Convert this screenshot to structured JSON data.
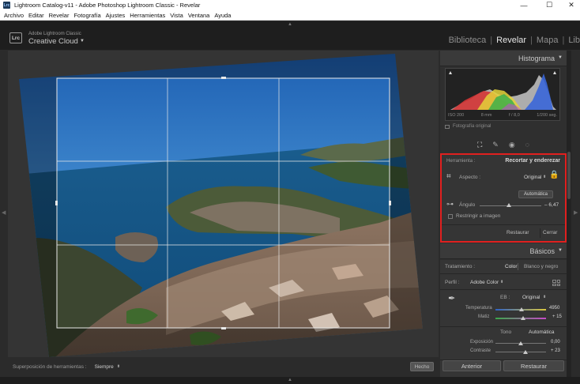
{
  "window": {
    "title": "Lightroom Catalog-v11 - Adobe Photoshop Lightroom Classic - Revelar",
    "app_icon": "Lrc",
    "controls": [
      "—",
      "☐",
      "✕"
    ]
  },
  "menu": [
    "Archivo",
    "Editar",
    "Revelar",
    "Fotografía",
    "Ajustes",
    "Herramientas",
    "Vista",
    "Ventana",
    "Ayuda"
  ],
  "brand": {
    "badge": "Lrc",
    "small": "Adobe Lightroom Classic",
    "big": "Creative Cloud",
    "caret": "▼"
  },
  "modules": {
    "items": [
      "Biblioteca",
      "Revelar",
      "Mapa",
      "Lib"
    ],
    "active_index": 1
  },
  "toolbar": {
    "overlay_label": "Superposición de herramientas :",
    "overlay_value": "Siempre",
    "done_label": "Hecho"
  },
  "histogram": {
    "title": "Histograma",
    "iso": "ISO 200",
    "focal": "8 mm",
    "aperture": "f / 8,0",
    "shutter": "1/200 seg.",
    "original_photo_label": "Fotografía original"
  },
  "crop": {
    "tools_label": "Herramienta :",
    "title": "Recortar y enderezar",
    "aspect_label": "Aspecto :",
    "aspect_value": "Original",
    "auto_label": "Automática",
    "angle_label": "Ángulo",
    "angle_value": "– 6,47",
    "angle_slider_fraction": 0.47,
    "constrain_label": "Restringir a imagen",
    "reset_label": "Restaurar",
    "close_label": "Cerrar"
  },
  "basics": {
    "title": "Básicos",
    "treatment_label": "Tratamiento :",
    "color_tab": "Color",
    "bw_tab": "Blanco y negro",
    "profile_label": "Perfil :",
    "profile_value": "Adobe Color",
    "wb_label": "EB :",
    "wb_value": "Original",
    "temp_label": "Temperatura",
    "temp_value": "4950",
    "temp_fraction": 0.52,
    "tint_label": "Matiz",
    "tint_value": "+ 15",
    "tint_fraction": 0.55,
    "tone_label": "Tono",
    "tone_auto": "Automática",
    "exposure_label": "Exposición",
    "exposure_value": "0,00",
    "exposure_fraction": 0.5,
    "contrast_label": "Contraste",
    "contrast_value": "+ 23",
    "contrast_fraction": 0.6
  },
  "bottom_buttons": {
    "previous": "Anterior",
    "reset": "Restaurar"
  },
  "colors": {
    "highlight_box": "#e0201f",
    "panel_bg": "#2f2f2f",
    "viewer_bg": "#505050"
  }
}
